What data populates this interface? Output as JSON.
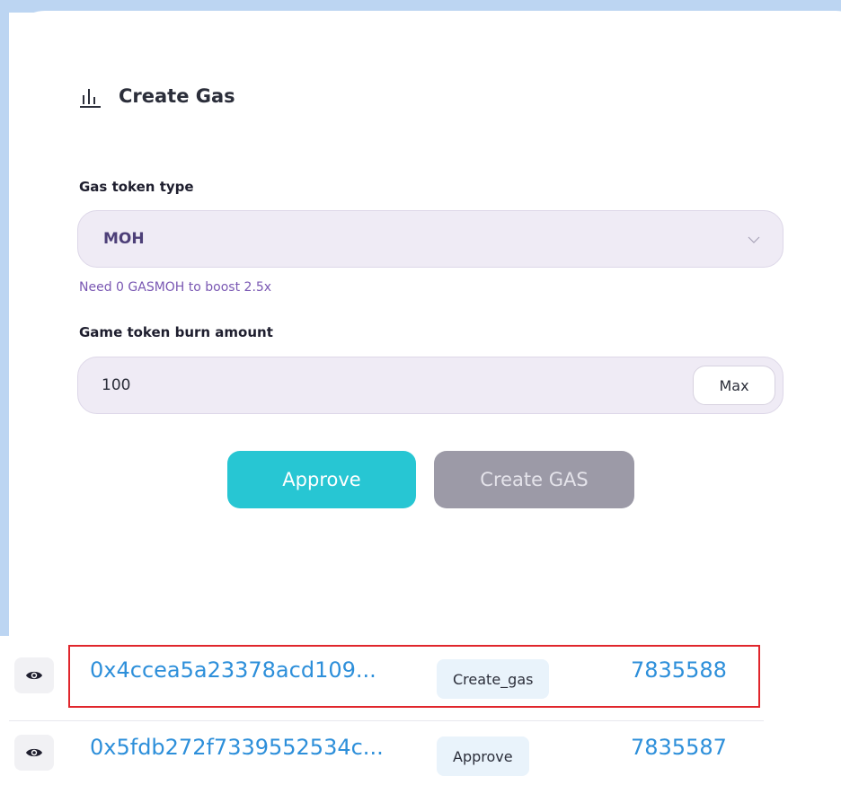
{
  "card": {
    "title": "Create Gas",
    "title_icon": "bar-chart-icon",
    "gas_token_type": {
      "label": "Gas token type",
      "selected": "MOH",
      "icon": "chevron-down-icon"
    },
    "boost_hint": "Need 0 GASMOH to boost 2.5x",
    "burn_amount": {
      "label": "Game token burn amount",
      "value": "100",
      "max_label": "Max"
    },
    "buttons": {
      "approve_label": "Approve",
      "create_label": "Create GAS"
    }
  },
  "transactions": [
    {
      "hash": "0x4ccea5a23378acd109...",
      "method": "Create_gas",
      "block": "7835588",
      "highlighted": true,
      "icon": "eye-icon"
    },
    {
      "hash": "0x5fdb272f7339552534c...",
      "method": "Approve",
      "block": "7835587",
      "highlighted": false,
      "icon": "eye-icon"
    }
  ],
  "colors": {
    "accent": "#27c6d3",
    "disabled": "#9c9aa7",
    "link": "#2d8fda",
    "hint": "#7a58b3",
    "highlight_border": "#e0262c",
    "input_background": "#efebf5"
  }
}
